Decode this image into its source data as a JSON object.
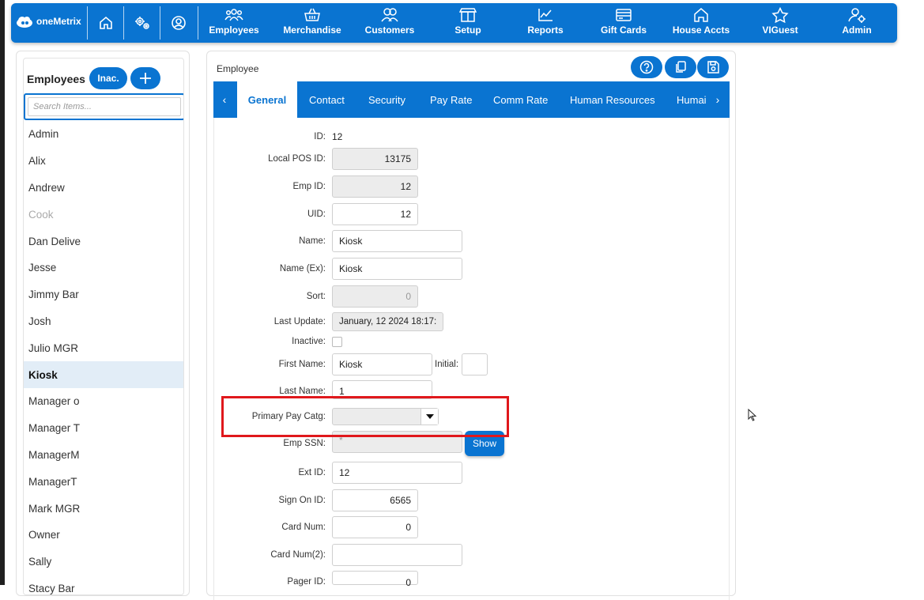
{
  "app": {
    "brand": "oneMetrix"
  },
  "nav": {
    "items": [
      {
        "label": "Employees",
        "icon": "people-group-icon"
      },
      {
        "label": "Merchandise",
        "icon": "basket-icon"
      },
      {
        "label": "Customers",
        "icon": "customers-icon"
      },
      {
        "label": "Setup",
        "icon": "box-icon"
      },
      {
        "label": "Reports",
        "icon": "chart-line-icon"
      },
      {
        "label": "Gift Cards",
        "icon": "gift-card-icon"
      },
      {
        "label": "House Accts",
        "icon": "house-icon"
      },
      {
        "label": "VIGuest",
        "icon": "star-icon"
      },
      {
        "label": "Admin",
        "icon": "admin-user-icon"
      }
    ]
  },
  "employees_panel": {
    "title": "Employees",
    "inactive_button": "Inac.",
    "search_placeholder": "Search Items...",
    "list": [
      {
        "name": "Admin",
        "state": "normal"
      },
      {
        "name": "Alix",
        "state": "normal"
      },
      {
        "name": "Andrew",
        "state": "normal"
      },
      {
        "name": "Cook",
        "state": "inactive"
      },
      {
        "name": "Dan Delive",
        "state": "normal"
      },
      {
        "name": "Jesse",
        "state": "normal"
      },
      {
        "name": "Jimmy Bar",
        "state": "normal"
      },
      {
        "name": "Josh",
        "state": "normal"
      },
      {
        "name": "Julio MGR",
        "state": "normal"
      },
      {
        "name": "Kiosk",
        "state": "selected"
      },
      {
        "name": "Manager o",
        "state": "normal"
      },
      {
        "name": "Manager T",
        "state": "normal"
      },
      {
        "name": "ManagerM",
        "state": "normal"
      },
      {
        "name": "ManagerT",
        "state": "normal"
      },
      {
        "name": "Mark MGR",
        "state": "normal"
      },
      {
        "name": "Owner",
        "state": "normal"
      },
      {
        "name": "Sally",
        "state": "normal"
      },
      {
        "name": "Stacy Bar",
        "state": "normal"
      }
    ]
  },
  "main": {
    "title": "Employee",
    "tabs": [
      {
        "label": "General",
        "active": true
      },
      {
        "label": "Contact",
        "active": false
      },
      {
        "label": "Security",
        "active": false
      },
      {
        "label": "Pay Rate",
        "active": false
      },
      {
        "label": "Comm Rate",
        "active": false
      },
      {
        "label": "Human Resources",
        "active": false
      },
      {
        "label": "Humai",
        "active": false
      }
    ],
    "fields": {
      "id": {
        "label": "ID:",
        "value": "12"
      },
      "local_pos_id": {
        "label": "Local POS ID:",
        "value": "13175"
      },
      "emp_id": {
        "label": "Emp ID:",
        "value": "12"
      },
      "uid": {
        "label": "UID:",
        "value": "12"
      },
      "name": {
        "label": "Name:",
        "value": "Kiosk"
      },
      "name_ex": {
        "label": "Name (Ex):",
        "value": "Kiosk"
      },
      "sort": {
        "label": "Sort:",
        "value": "0"
      },
      "last_update": {
        "label": "Last Update:",
        "value": "January, 12 2024 18:17:"
      },
      "inactive": {
        "label": "Inactive:",
        "checked": false
      },
      "first_name": {
        "label": "First Name:",
        "value": "Kiosk"
      },
      "initial": {
        "label": "Initial:",
        "value": ""
      },
      "last_name": {
        "label": "Last Name:",
        "value": "1"
      },
      "primary_pay_catg": {
        "label": "Primary Pay Catg:",
        "value": ""
      },
      "emp_ssn": {
        "label": "Emp SSN:",
        "value": "*"
      },
      "show_button": "Show",
      "ext_id": {
        "label": "Ext ID:",
        "value": "12"
      },
      "sign_on_id": {
        "label": "Sign On ID:",
        "value": "6565"
      },
      "card_num": {
        "label": "Card Num:",
        "value": "0"
      },
      "card_num2": {
        "label": "Card Num(2):",
        "value": ""
      },
      "pager_id": {
        "label": "Pager ID:",
        "value": "0"
      }
    }
  },
  "colors": {
    "brand_blue": "#0a74d1",
    "highlight_red": "#e0181c",
    "selected_row": "#e2edf7"
  }
}
